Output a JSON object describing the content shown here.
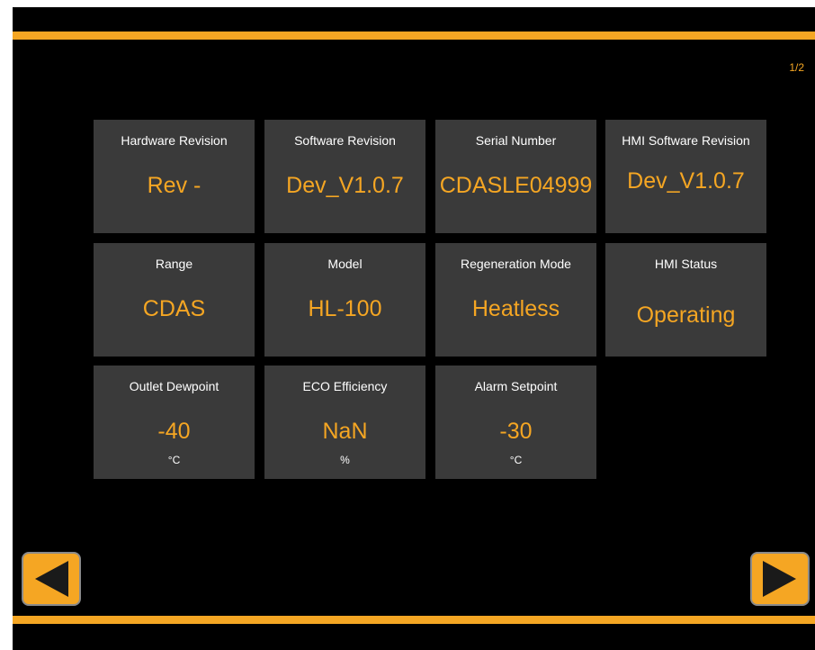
{
  "header": {
    "page_indicator": "1/2"
  },
  "tiles": [
    {
      "label": "Hardware Revision",
      "value": "Rev -"
    },
    {
      "label": "Software Revision",
      "value": "Dev_V1.0.7"
    },
    {
      "label": "Serial Number",
      "value": "CDASLE04999"
    },
    {
      "label": "HMI Software Revision",
      "value": "Dev_V1.0.7"
    },
    {
      "label": "Range",
      "value": "CDAS"
    },
    {
      "label": "Model",
      "value": "HL-100"
    },
    {
      "label": "Regeneration Mode",
      "value": "Heatless"
    },
    {
      "label": "HMI Status",
      "value": "Operating"
    },
    {
      "label": "Outlet Dewpoint",
      "value": "-40",
      "unit": "°C"
    },
    {
      "label": "ECO Efficiency",
      "value": "NaN",
      "unit": "%"
    },
    {
      "label": "Alarm Setpoint",
      "value": "-30",
      "unit": "°C"
    }
  ],
  "nav": {
    "prev_icon": "arrow-left-icon",
    "next_icon": "arrow-right-icon"
  },
  "colors": {
    "accent": "#f5a623",
    "tile_bg": "#3a3a3a",
    "background": "#000000"
  }
}
